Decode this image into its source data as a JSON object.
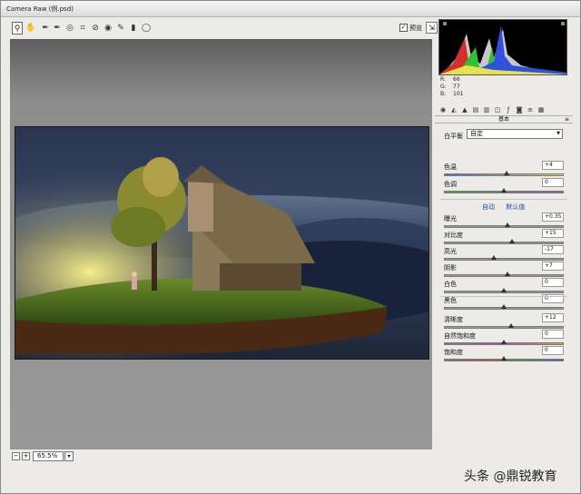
{
  "window": {
    "title": "Camera Raw (例.psd)"
  },
  "toolbar": {
    "tools": [
      {
        "name": "zoom-tool",
        "glyph": "🔍"
      },
      {
        "name": "hand-tool",
        "glyph": "✋"
      },
      {
        "name": "white-balance-tool",
        "glyph": "✒"
      },
      {
        "name": "color-sampler-tool",
        "glyph": "✒"
      },
      {
        "name": "targeted-adjustment-tool",
        "glyph": "◎"
      },
      {
        "name": "crop-tool",
        "glyph": "⌗"
      },
      {
        "name": "straighten-tool",
        "glyph": "✂"
      },
      {
        "name": "spot-removal-tool",
        "glyph": "⊘"
      },
      {
        "name": "red-eye-tool",
        "glyph": "◉"
      },
      {
        "name": "adjustment-brush-tool",
        "glyph": "✎"
      },
      {
        "name": "graduated-filter-tool",
        "glyph": "▮"
      },
      {
        "name": "radial-filter-tool",
        "glyph": "◯"
      }
    ],
    "preview_label": "预览",
    "preview_checked": "✓"
  },
  "status": {
    "zoom": "65.5%",
    "minus": "−",
    "plus": "+"
  },
  "histogram": {
    "r_label": "R:",
    "r": "66",
    "g_label": "G:",
    "g": "77",
    "b_label": "B:",
    "b": "101"
  },
  "panel": {
    "section_title": "基本",
    "white_balance_label": "白平衡",
    "white_balance_value": "自定",
    "auto_link": "自动",
    "default_link": "默认值",
    "sliders": [
      {
        "key": "temperature",
        "label": "色温",
        "value": "+4",
        "pos": 0.52,
        "track": "temp"
      },
      {
        "key": "tint",
        "label": "色调",
        "value": "0",
        "pos": 0.5,
        "track": "tint"
      },
      {
        "key": "exposure",
        "label": "曝光",
        "value": "+0.35",
        "pos": 0.53,
        "track": ""
      },
      {
        "key": "contrast",
        "label": "对比度",
        "value": "+15",
        "pos": 0.57,
        "track": ""
      },
      {
        "key": "highlights",
        "label": "高光",
        "value": "-17",
        "pos": 0.42,
        "track": ""
      },
      {
        "key": "shadows",
        "label": "阴影",
        "value": "+7",
        "pos": 0.53,
        "track": ""
      },
      {
        "key": "whites",
        "label": "白色",
        "value": "0",
        "pos": 0.5,
        "track": ""
      },
      {
        "key": "blacks",
        "label": "黑色",
        "value": "0",
        "pos": 0.5,
        "track": ""
      },
      {
        "key": "clarity",
        "label": "清晰度",
        "value": "+12",
        "pos": 0.56,
        "track": ""
      },
      {
        "key": "vibrance",
        "label": "自然饱和度",
        "value": "0",
        "pos": 0.5,
        "track": "vib"
      },
      {
        "key": "saturation",
        "label": "饱和度",
        "value": "0",
        "pos": 0.5,
        "track": "sat"
      }
    ]
  },
  "watermark": "头条 @鼎锐教育"
}
